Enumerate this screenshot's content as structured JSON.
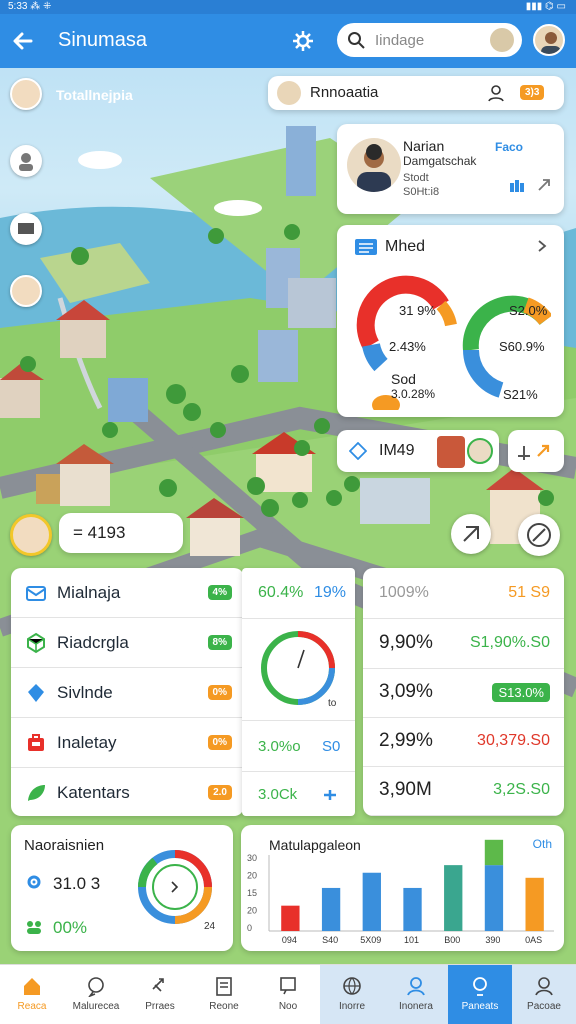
{
  "status_bar": {
    "left": "5:33 ⁂ ⁜",
    "right": "▮▮▮ ⌬ ▭"
  },
  "app_bar": {
    "title": "Sinumasa",
    "search_placeholder": "Iindage"
  },
  "map": {
    "user_label": "Totallnejpia",
    "info_card": {
      "title": "Rnnoaatia",
      "badge": "3)3"
    },
    "profile_card": {
      "name": "Narian",
      "subtitle": "Damgatschak",
      "line3": "Stodt",
      "line4": "S0Ht:i8",
      "action": "Faco"
    },
    "mhed_card": {
      "title": "Mhed",
      "left_top_value": "31 9%",
      "left_mid_value": "2.43%",
      "left_label": "Sod",
      "left_bottom_value": "3.0.28%",
      "right_top_value": "S2.0%",
      "right_mid_value": "S60.9%",
      "right_bottom_value": "S21%"
    },
    "mini_card": {
      "value": "IM49"
    },
    "count_pill": {
      "value": "= 4193"
    }
  },
  "stats_list": [
    {
      "label": "Mialnaja",
      "badge": "4%",
      "color": "#3bb34a",
      "icon": "mail-icon"
    },
    {
      "label": "Riadcrgla",
      "badge": "8%",
      "color": "#3bb34a",
      "icon": "cube-icon"
    },
    {
      "label": "Sivlnde",
      "badge": "0%",
      "color": "#f59a23",
      "icon": "user-icon"
    },
    {
      "label": "Inaletay",
      "badge": "0%",
      "color": "#f59a23",
      "icon": "briefcase-icon"
    },
    {
      "label": "Katentars",
      "badge": "2.0",
      "color": "#f59a23",
      "icon": "leaf-icon"
    }
  ],
  "middle_card": {
    "top_left": "60.4%",
    "top_right": "19%",
    "gauge_note": "to",
    "row3_left": "3.0%o",
    "row3_right": "S0",
    "row4_left": "3.0Ck"
  },
  "right_card": {
    "header_left": "1009%",
    "header_right": "51 S9",
    "rows": [
      {
        "left": "9,90%",
        "right": "S1,90%.S0",
        "right_color": "#3bb34a",
        "badge": false
      },
      {
        "left": "3,09%",
        "right": "S13.0%",
        "right_color": "#3bb34a",
        "badge": true
      },
      {
        "left": "2,99%",
        "right": "30,379.S0",
        "right_color": "#e0382a",
        "badge": false
      },
      {
        "left": "3,90M",
        "right": "3,2S.S0",
        "right_color": "#3bb34a",
        "badge": false
      }
    ]
  },
  "donut_card": {
    "title": "Naoraisnien",
    "value1": "31.0 3",
    "value2": "00%",
    "note": "24"
  },
  "chart_card": {
    "title": "Matulapgaleon",
    "corner": "Oth"
  },
  "chart_data": {
    "type": "bar",
    "categories": [
      "094",
      "S40",
      "5X09",
      "101",
      "B00",
      "390",
      "0AS"
    ],
    "series": [
      {
        "values": [
          10,
          17,
          23,
          17,
          26,
          26,
          21
        ]
      }
    ],
    "yticks": [
      "30",
      "20",
      "15",
      "20",
      "0"
    ],
    "colors": [
      "#e8302a",
      "#3a8fdc",
      "#3a8fdc",
      "#3a8fdc",
      "#3aa68f",
      "#3a8fdc",
      "#f59a23"
    ],
    "stack_top": {
      "index": 5,
      "value": 10,
      "color": "#5db94a"
    }
  },
  "bottom_nav": [
    {
      "label": "Reaca",
      "icon": "home-icon",
      "active": "orange"
    },
    {
      "label": "Malurecea",
      "icon": "chat-icon"
    },
    {
      "label": "Prraes",
      "icon": "tag-icon"
    },
    {
      "label": "Reone",
      "icon": "document-icon"
    },
    {
      "label": "Noo",
      "icon": "message-icon"
    },
    {
      "label": "Inorre",
      "icon": "globe-icon"
    },
    {
      "label": "Inonera",
      "icon": "person-icon"
    },
    {
      "label": "Paneats",
      "icon": "search-person-icon",
      "active": "blue"
    },
    {
      "label": "Pacoae",
      "icon": "account-icon"
    }
  ]
}
